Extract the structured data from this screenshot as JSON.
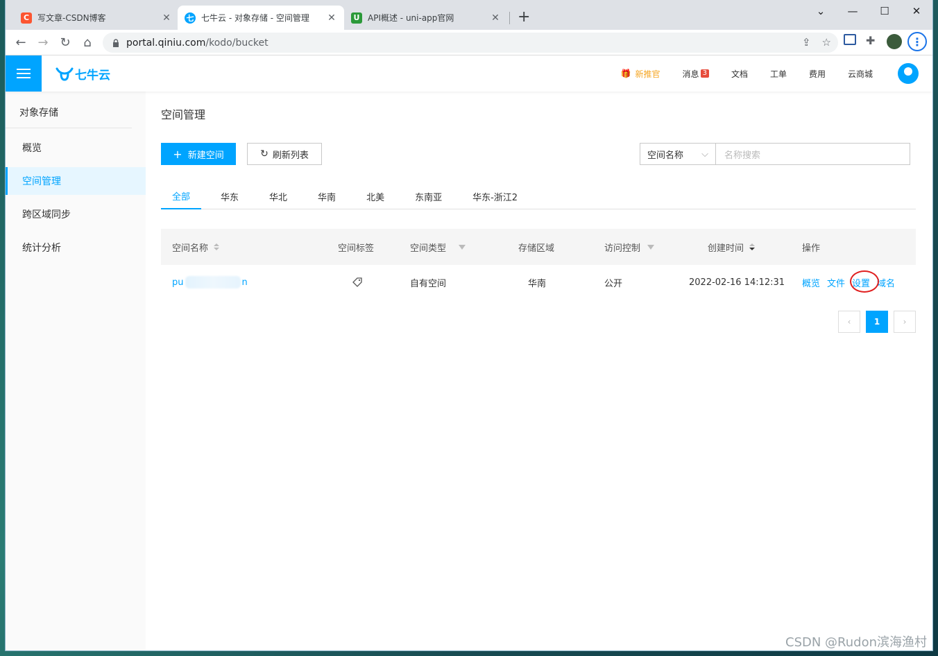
{
  "browser": {
    "tabs": [
      {
        "title": "写文章-CSDN博客",
        "favicon": "C",
        "favicon_color": "#fc5531"
      },
      {
        "title": "七牛云 - 对象存储 - 空间管理",
        "favicon": "七",
        "favicon_color": "#00a4ff"
      },
      {
        "title": "API概述 - uni-app官网",
        "favicon": "U",
        "favicon_color": "#2b9939"
      }
    ],
    "url_host": "portal.qiniu.com",
    "url_path": "/kodo/bucket"
  },
  "header": {
    "logo_text": "七牛云",
    "nav": {
      "new_user": "新推官",
      "messages": "消息",
      "messages_count": "3",
      "docs": "文档",
      "tickets": "工单",
      "billing": "费用",
      "market": "云商城"
    }
  },
  "sidebar": {
    "title": "对象存储",
    "items": [
      "概览",
      "空间管理",
      "跨区域同步",
      "统计分析"
    ]
  },
  "main": {
    "page_title": "空间管理",
    "new_bucket_label": "新建空间",
    "refresh_label": "刷新列表",
    "search_field_select": "空间名称",
    "search_placeholder": "名称搜索",
    "region_tabs": [
      "全部",
      "华东",
      "华北",
      "华南",
      "北美",
      "东南亚",
      "华东-浙江2"
    ],
    "table": {
      "headers": {
        "name": "空间名称",
        "tag": "空间标签",
        "type": "空间类型",
        "region": "存储区域",
        "access": "访问控制",
        "created": "创建时间",
        "ops": "操作"
      },
      "rows": [
        {
          "name_prefix": "pu",
          "name_suffix": "n",
          "type": "自有空间",
          "region": "华南",
          "access": "公开",
          "created": "2022-02-16 14:12:31",
          "ops": [
            "概览",
            "文件",
            "设置",
            "域名"
          ]
        }
      ]
    },
    "pagination": {
      "current_page": "1"
    }
  },
  "watermark": "CSDN @Rudon滨海渔村",
  "colors": {
    "accent": "#00a4ff",
    "highlight_circle": "#e02020"
  }
}
